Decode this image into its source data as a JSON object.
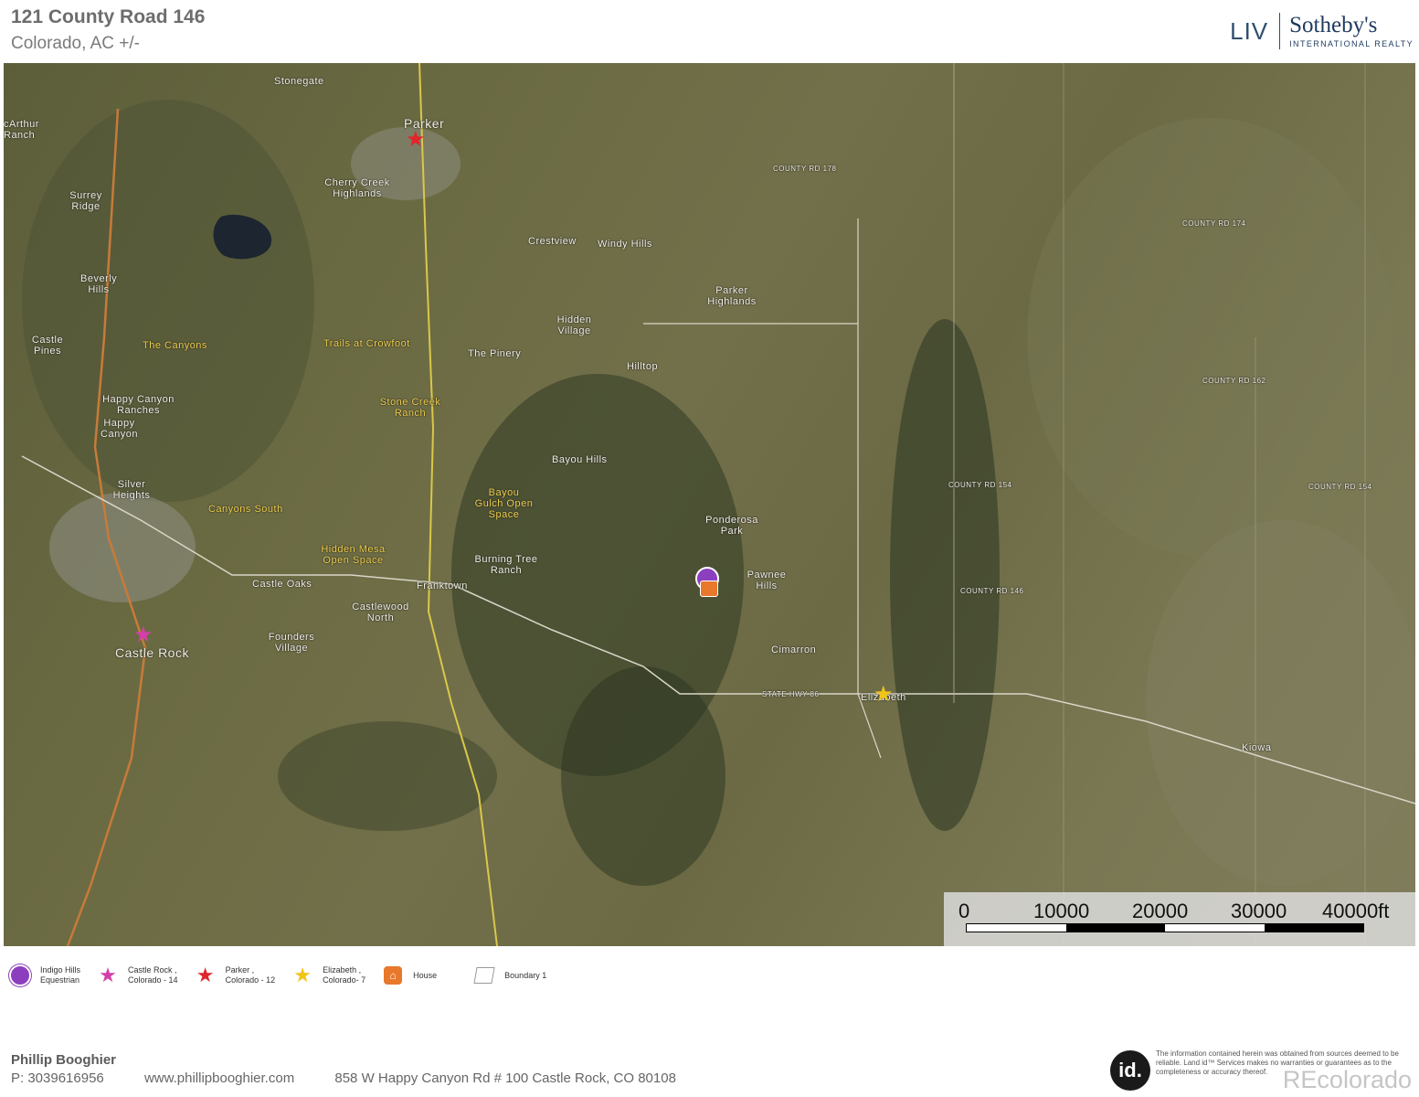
{
  "header": {
    "title": "121 County Road 146",
    "subtitle": "Colorado,  AC +/-",
    "brand_liv": "LIV",
    "brand_name": "Sotheby's",
    "brand_tag": "INTERNATIONAL REALTY"
  },
  "map": {
    "places": {
      "parker": "Parker",
      "stonegate": "Stonegate",
      "cherry_creek": "Cherry Creek Highlands",
      "surrey": "Surrey Ridge",
      "mcarthur": "cArthur Ranch",
      "beverly": "Beverly Hills",
      "castle_pines": "Castle Pines",
      "the_canyons": "The Canyons",
      "happy_canyon_ranches": "Happy Canyon Ranches",
      "happy_canyon": "Happy Canyon",
      "silver_heights": "Silver Heights",
      "canyons_south": "Canyons South",
      "castle_oaks": "Castle Oaks",
      "castlewood_north": "Castlewood North",
      "founders": "Founders Village",
      "castle_rock": "Castle Rock",
      "crestview": "Crestview",
      "windy_hills": "Windy Hills",
      "parker_highlands": "Parker Highlands",
      "hidden_village": "Hidden Village",
      "the_pinery": "The Pinery",
      "hilltop": "Hilltop",
      "trails_crowfoot": "Trails at Crowfoot",
      "stone_creek": "Stone Creek Ranch",
      "bayou_hills": "Bayou Hills",
      "bayou_gulch": "Bayou Gulch Open Space",
      "ponderosa": "Ponderosa Park",
      "pawnee": "Pawnee Hills",
      "hidden_mesa": "Hidden Mesa Open Space",
      "burning_tree": "Burning Tree Ranch",
      "franktown": "Franktown",
      "cimarron": "Cimarron",
      "elizabeth": "Elizabeth",
      "kiowa": "Kiowa",
      "county_rd_174": "COUNTY RD 174",
      "county_rd_162": "COUNTY RD 162",
      "county_rd_154a": "COUNTY RD 154",
      "county_rd_154b": "COUNTY RD 154",
      "county_rd_146": "COUNTY RD 146",
      "county_rd_178": "COUNTY RD 178",
      "state_hwy_86": "STATE HWY 86"
    },
    "scale": {
      "labels": [
        "0",
        "10000",
        "20000",
        "30000",
        "40000ft"
      ]
    }
  },
  "legend": [
    {
      "icon": "indigo-hills-pin-icon",
      "label": "Indigo Hills\nEquestrian",
      "color": "#8b3fbf"
    },
    {
      "icon": "castle-rock-star-icon",
      "label": "Castle Rock ,\nColorado - 14",
      "color": "#d23fa8"
    },
    {
      "icon": "parker-star-icon",
      "label": "Parker ,\nColorado - 12",
      "color": "#e0262b"
    },
    {
      "icon": "elizabeth-star-icon",
      "label": "Elizabeth ,\nColorado- 7",
      "color": "#f0c419"
    },
    {
      "icon": "house-icon",
      "label": "House",
      "color": "#e8782c"
    },
    {
      "icon": "boundary-icon",
      "label": "Boundary 1",
      "color": "#999999"
    }
  ],
  "footer": {
    "name": "Phillip Booghier",
    "phone": "P: 3039616956",
    "website": "www.phillipbooghier.com",
    "address": "858 W Happy Canyon Rd # 100 Castle Rock, CO 80108",
    "id_logo": "id.",
    "disclaimer": "The information contained herein was obtained from sources deemed to be reliable. Land id™ Services makes no warranties or guarantees as to the completeness or accuracy thereof.",
    "watermark": "REcolorado"
  }
}
